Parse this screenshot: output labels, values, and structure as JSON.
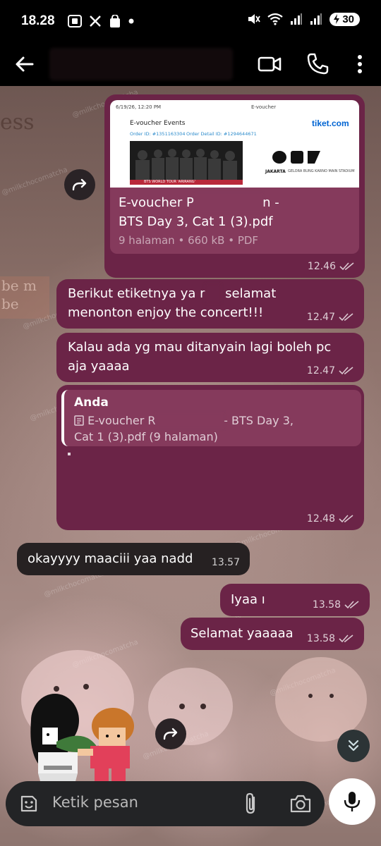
{
  "status_bar": {
    "time": "18.28",
    "battery": "30"
  },
  "header": {
    "back_icon": "arrow-left-icon",
    "video_icon": "video-camera-icon",
    "call_icon": "phone-icon",
    "menu_icon": "more-vertical-icon"
  },
  "background": {
    "text_1": "ess",
    "text_2": "be m\nbe",
    "watermark": "@milkchocomatcha"
  },
  "document_message": {
    "preview": {
      "date": "6/19/26, 12:20 PM",
      "header_right": "E-voucher",
      "title": "E-voucher Events",
      "order_id": "Order ID: #1351163304",
      "order_detail_id": "Order Detail ID: #1294644671",
      "brand": "tiket.com",
      "banner_text": "BTS WORLD TOUR 'ARIRANG'",
      "venue_title": "JAKARTA",
      "venue": "GELORA BUNG KARNO MAIN STADIUM"
    },
    "title_start": "E-voucher P",
    "title_end": "n -",
    "title_line2": "BTS Day 3, Cat 1 (3).pdf",
    "meta": "9 halaman • 660 kB • PDF",
    "time": "12.46"
  },
  "messages": [
    {
      "id": "m1",
      "text_a": "Berikut etiketnya ya r",
      "text_b": " selamat",
      "text_line2": "menonton enjoy the concert!!!",
      "time": "12.47"
    },
    {
      "id": "m2",
      "text_line1": "Kalau ada yg mau ditanyain lagi boleh pc",
      "text_line2": "aja yaaaa",
      "time": "12.47"
    },
    {
      "id": "m3",
      "quote_author": "Anda",
      "quote_start": "E-voucher R",
      "quote_end": "- BTS Day 3,",
      "quote_line2": "Cat 1 (3).pdf (9 halaman)",
      "time": "12.48"
    },
    {
      "id": "m4",
      "text": "okayyyy maaciii yaa nadd",
      "time": "13.57"
    },
    {
      "id": "m5",
      "text": "Iyaa ı",
      "time": "13.58"
    },
    {
      "id": "m6",
      "text": "Selamat yaaaaa",
      "time": "13.58"
    }
  ],
  "input": {
    "placeholder": "Ketik pesan",
    "emoji_icon": "emoji-icon",
    "attach_icon": "paperclip-icon",
    "camera_icon": "camera-icon",
    "mic_icon": "microphone-icon"
  },
  "colors": {
    "outgoing_bubble": "#6b2447",
    "incoming_bubble": "#262122",
    "header": "#000000"
  }
}
